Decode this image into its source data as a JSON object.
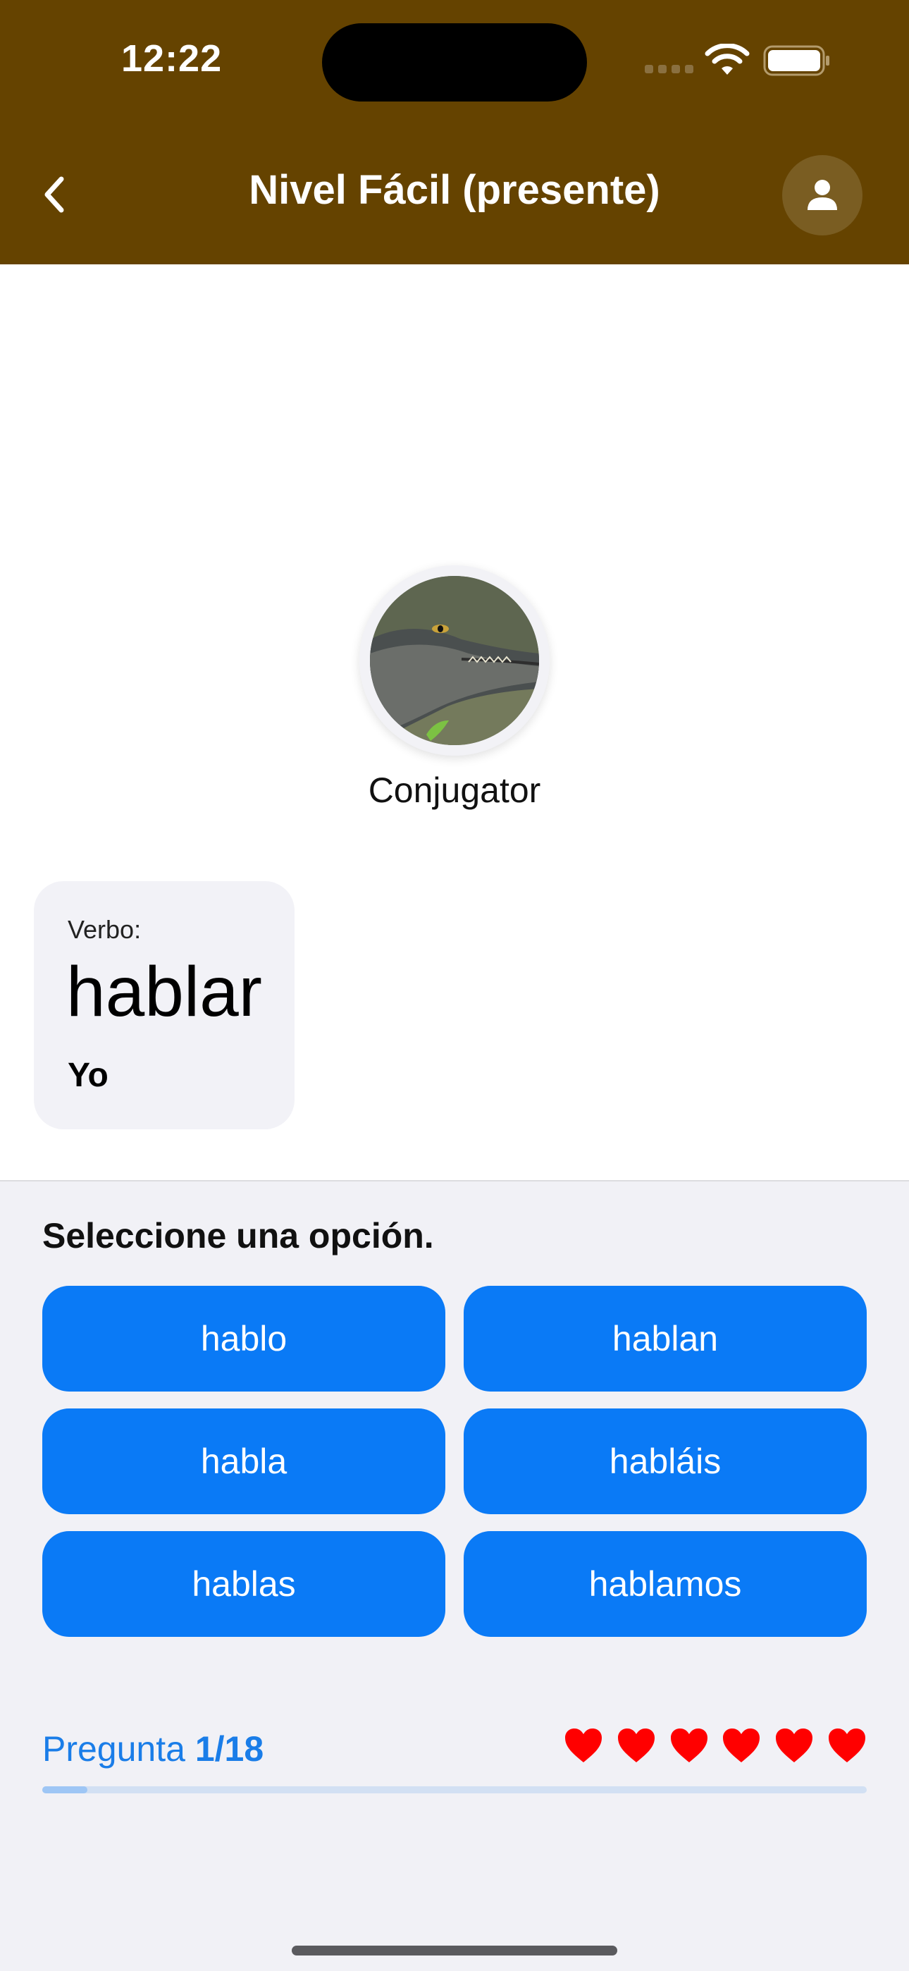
{
  "status_bar": {
    "time": "12:22"
  },
  "nav": {
    "title": "Nivel Fácil (presente)",
    "back_icon": "chevron-left-icon",
    "profile_icon": "person-icon"
  },
  "character": {
    "name": "Conjugator"
  },
  "verb_card": {
    "label": "Verbo:",
    "verb": "hablar",
    "person": "Yo"
  },
  "quiz": {
    "prompt": "Seleccione una opción.",
    "options": [
      "hablo",
      "hablan",
      "habla",
      "habláis",
      "hablas",
      "hablamos"
    ]
  },
  "progress": {
    "label": "Pregunta",
    "value": "1/18",
    "current": 1,
    "total": 18,
    "fraction": 0.055,
    "hearts": 6
  },
  "colors": {
    "header": "#654300",
    "accent": "#0a7af6",
    "heart": "#ff0000",
    "progress_text": "#1a7de8"
  }
}
